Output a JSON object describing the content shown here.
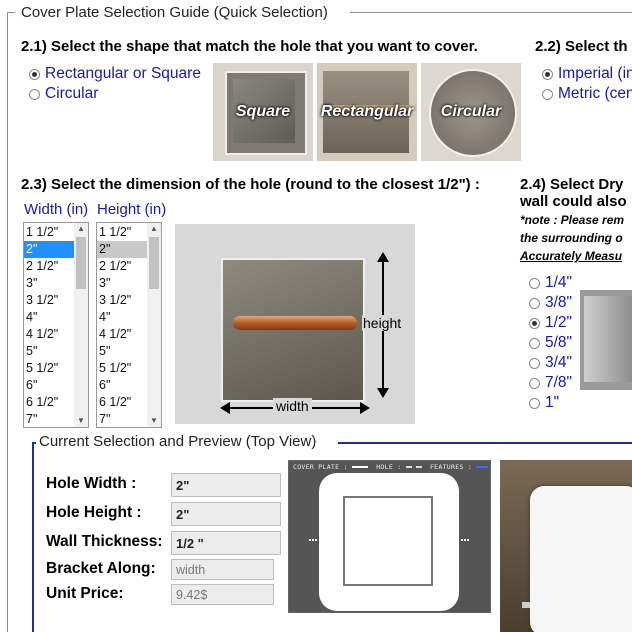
{
  "guide": {
    "legend": "Cover Plate Selection Guide (Quick Selection)"
  },
  "shape": {
    "heading": "2.1) Select the shape that match the hole that you want to cover.",
    "options": [
      {
        "label": "Rectangular or Square",
        "checked": true
      },
      {
        "label": "Circular",
        "checked": false
      }
    ],
    "images": [
      {
        "caption": "Square"
      },
      {
        "caption": "Rectangular"
      },
      {
        "caption": "Circular"
      }
    ]
  },
  "units": {
    "heading": "2.2) Select th",
    "options": [
      {
        "label": "Imperial (in",
        "checked": true
      },
      {
        "label": "Metric (cen",
        "checked": false
      }
    ]
  },
  "dimension": {
    "heading": "2.3) Select the dimension of the hole (round to the closest 1/2\") :",
    "width_label": "Width (in)",
    "height_label": "Height (in)",
    "width_options": [
      "1 1/2\"",
      "2\"",
      "2 1/2\"",
      "3\"",
      "3 1/2\"",
      "4\"",
      "4 1/2\"",
      "5\"",
      "5 1/2\"",
      "6\"",
      "6 1/2\"",
      "7\""
    ],
    "height_options": [
      "1 1/2\"",
      "2\"",
      "2 1/2\"",
      "3\"",
      "3 1/2\"",
      "4\"",
      "4 1/2\"",
      "5\"",
      "5 1/2\"",
      "6\"",
      "6 1/2\"",
      "7\""
    ],
    "selected_index": 1,
    "diagram": {
      "height_text": "height",
      "width_text": "width"
    }
  },
  "drywall": {
    "heading_line1": "2.4) Select Dry",
    "heading_line2": "wall could also",
    "note_line1": "*note : Please rem",
    "note_line2": "the surrounding o",
    "note_line3": "Accurately Measu",
    "options": [
      {
        "label": "1/4\"",
        "checked": false
      },
      {
        "label": "3/8\"",
        "checked": false
      },
      {
        "label": "1/2\"",
        "checked": true
      },
      {
        "label": "5/8\"",
        "checked": false
      },
      {
        "label": "3/4\"",
        "checked": false
      },
      {
        "label": "7/8\"",
        "checked": false
      },
      {
        "label": "1\"",
        "checked": false
      }
    ]
  },
  "current": {
    "legend": "Current Selection and Preview (Top View)",
    "hole_width_label": "Hole Width :",
    "hole_width_value": "2\"",
    "hole_height_label": "Hole Height :",
    "hole_height_value": "2\"",
    "wall_label": "Wall Thickness:",
    "wall_value": "1/2 \"",
    "bracket_label": "Bracket Along:",
    "bracket_value": "width",
    "price_label": "Unit Price:",
    "price_value": "9.42$",
    "preview_legend": {
      "cover": "COVER PLATE :",
      "hole": "HOLE :",
      "featured": "FEATURES :"
    }
  },
  "colors": {
    "link": "#1a1aa6",
    "accent_blue": "#1e90ff",
    "frame_blue": "#1f2f9a"
  }
}
